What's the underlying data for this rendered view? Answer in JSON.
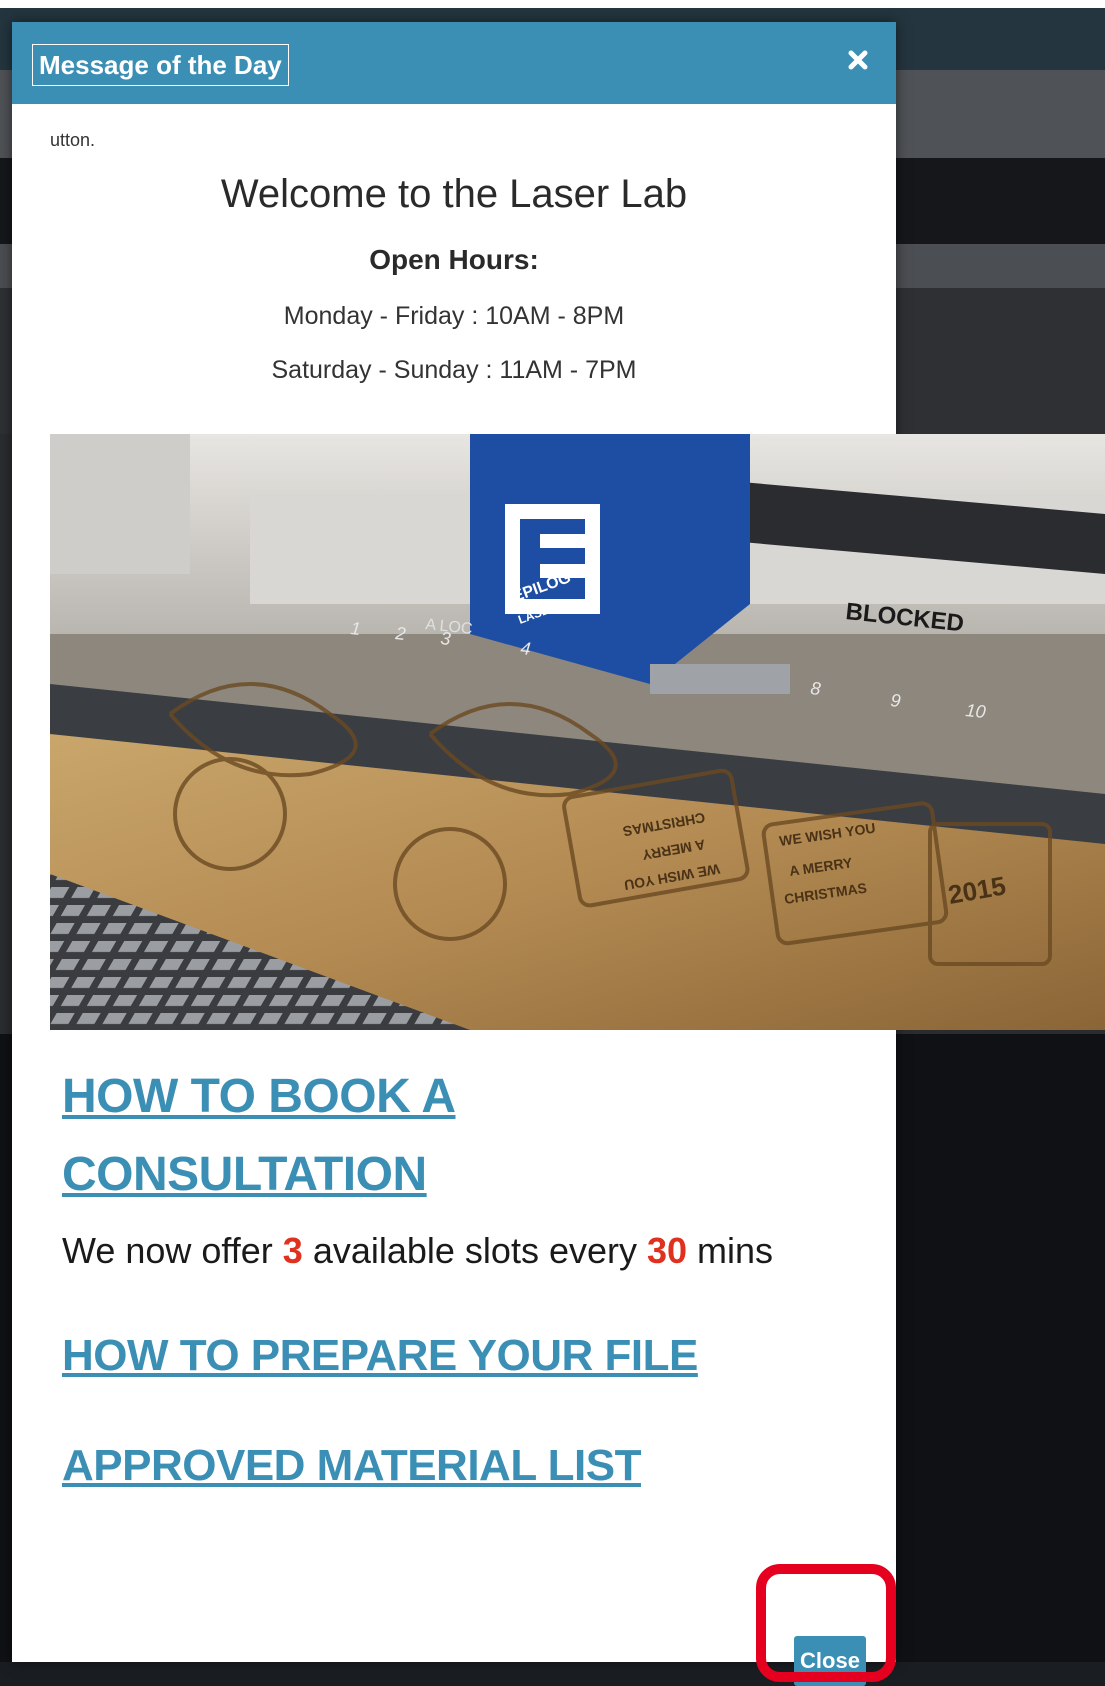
{
  "modal": {
    "title": "Message of the Day",
    "close_icon": "close-icon",
    "clipped_text": "utton.",
    "welcome": "Welcome to the Laser Lab",
    "hours_title": "Open Hours:",
    "hours_weekdays": "Monday - Friday : 10AM - 8PM",
    "hours_weekend": "Saturday - Sunday : 11AM - 7PM",
    "photo": {
      "machine_brand_top": "EPILOG",
      "machine_brand_bottom": "LASER",
      "blocked_label": "BLOCKED",
      "ruler_label": "A LOC",
      "ruler_numbers": [
        "1",
        "2",
        "3",
        "4",
        "8",
        "9",
        "10"
      ],
      "engraving_texts": [
        "CHRISTMAS",
        "A MERRY",
        "WE WISH YOU",
        "WE WISH YOU",
        "A MERRY",
        "CHRISTMAS",
        "2015"
      ]
    },
    "links": {
      "book_line1": "HOW TO BOOK A",
      "book_line2": "CONSULTATION",
      "prepare": "HOW TO PREPARE YOUR FILE",
      "materials": "APPROVED MATERIAL LIST"
    },
    "slots": {
      "prefix": "We now offer ",
      "count": "3",
      "middle": " available slots every ",
      "minutes": "30",
      "suffix": " mins"
    },
    "close_label": "Close"
  },
  "colors": {
    "accent": "#3b8fb5",
    "highlight_number": "#e0301e",
    "annotation_ring": "#e6001f"
  }
}
